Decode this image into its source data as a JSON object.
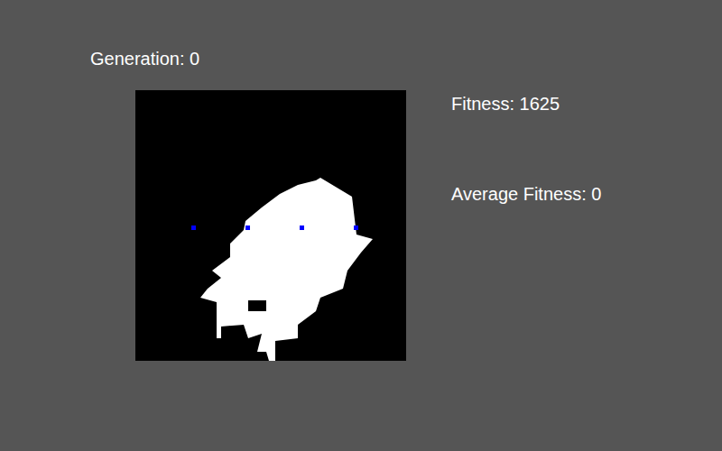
{
  "generation": {
    "label": "Generation: 0"
  },
  "fitness": {
    "label": "Fitness: 1625"
  },
  "average_fitness": {
    "label": "Average Fitness: 0"
  }
}
